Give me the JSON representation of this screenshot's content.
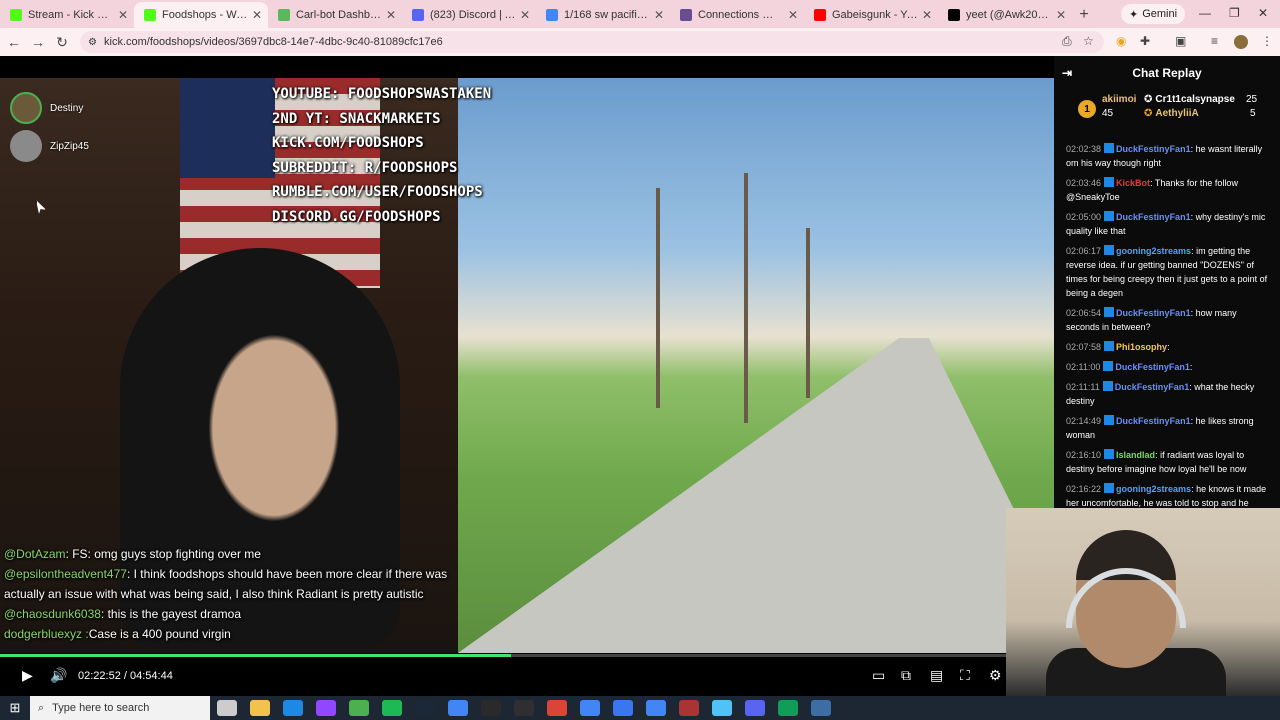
{
  "browser": {
    "tabs": [
      {
        "label": "Stream - Kick Dashboar",
        "favicon": "kick-icon",
        "color": "#53fc18",
        "active": false
      },
      {
        "label": "Foodshops - Watch the",
        "favicon": "kick-icon",
        "color": "#53fc18",
        "active": true
      },
      {
        "label": "Carl-bot Dashboard",
        "favicon": "carl-icon",
        "color": "#5cb85c",
        "active": false
      },
      {
        "label": "(823) Discord | Apps",
        "favicon": "discord-icon",
        "color": "#5865f2",
        "active": false
      },
      {
        "label": "1/168 sw pacific hwy -",
        "favicon": "google-icon",
        "color": "#4285f4",
        "active": false
      },
      {
        "label": "Connections — The Ne",
        "favicon": "nyt-icon",
        "color": "#6a4c93",
        "active": false
      },
      {
        "label": "Gabeisgunk - YouTube",
        "favicon": "youtube-icon",
        "color": "#ff0000",
        "active": false
      },
      {
        "label": "yeet (@Awk20000): \"N",
        "favicon": "x-icon",
        "color": "#000000",
        "active": false
      }
    ],
    "gemini_label": "Gemini",
    "url": "kick.com/foodshops/videos/3697dbc8-14e7-4dbc-9c40-81089cfc17e6",
    "window_controls": {
      "minimize": "—",
      "restore": "❐",
      "close": "✕"
    }
  },
  "video": {
    "stream_links": [
      "YOUTUBE: FOODSHOPSWASTAKEN",
      "2ND YT: SNACKMARKETS",
      "KICK.COM/FOODSHOPS",
      "SUBREDDIT: R/FOODSHOPS",
      "RUMBLE.COM/USER/FOODSHOPS",
      "DISCORD.GG/FOODSHOPS"
    ],
    "voice_users": [
      "Destiny",
      "ZipZip45"
    ],
    "overlay_chat": [
      {
        "user": "@DotAzam",
        "text": ": FS: omg guys stop fighting over me"
      },
      {
        "user": "@epsilontheadvent477",
        "text": ": I think foodshops should have been more clear if there was actually an issue with what was being said, I also think Radiant is pretty autistic"
      },
      {
        "user": "@chaosdunk6038",
        "text": ": this is the gayest dramoa"
      },
      {
        "user": "dodgerbluexyz :",
        "text": "Case is a 400 pound virgin"
      }
    ],
    "progress": 0.485,
    "current_time": "02:22:52",
    "separator": "/",
    "duration": "04:54:44"
  },
  "chat": {
    "title": "Chat Replay",
    "leaderboard": [
      {
        "rank": "1",
        "name": "akiimoi",
        "count": "45",
        "color": "#e9c46a"
      },
      {
        "name": "Cr1t1calsynapse",
        "count": "25",
        "color": "#ffffff"
      },
      {
        "name": "AethyliiA",
        "count": "5",
        "color": "#e9c46a"
      }
    ],
    "messages": [
      {
        "time": "02:02:38",
        "user": "DuckFestinyFan1",
        "color": "#6b8cff",
        "text": ": he wasnt literally om his way though right"
      },
      {
        "time": "02:03:46",
        "user": "KickBot",
        "color": "#e33b3b",
        "text": ": Thanks for the follow @SneakyToe"
      },
      {
        "time": "02:05:00",
        "user": "DuckFestinyFan1",
        "color": "#6b8cff",
        "text": ": why destiny's mic quality like that"
      },
      {
        "time": "02:06:17",
        "user": "gooning2streams",
        "color": "#4ea3ff",
        "text": ": im getting the reverse idea. if ur getting banned \"DOZENS\" of times for being creepy then it just gets to a point of being a degen"
      },
      {
        "time": "02:06:54",
        "user": "DuckFestinyFan1",
        "color": "#6b8cff",
        "text": ": how many seconds in between?"
      },
      {
        "time": "02:07:58",
        "user": "Phi1osophy",
        "color": "#f2c94c",
        "text": ":"
      },
      {
        "time": "02:11:00",
        "user": "DuckFestinyFan1",
        "color": "#6b8cff",
        "text": ":"
      },
      {
        "time": "02:11:11",
        "user": "DuckFestinyFan1",
        "color": "#6b8cff",
        "text": ": what the hecky destiny"
      },
      {
        "time": "02:14:49",
        "user": "DuckFestinyFan1",
        "color": "#6b8cff",
        "text": ": he likes strong woman"
      },
      {
        "time": "02:16:10",
        "user": "Islandlad",
        "color": "#7ed957",
        "text": ": if radiant was loyal to destiny before imagine how loyal he'll be now"
      },
      {
        "time": "02:16:22",
        "user": "gooning2streams",
        "color": "#4ea3ff",
        "text": ": he knows it made her uncomfortable, he was told to stop and he"
      }
    ]
  },
  "taskbar": {
    "search_placeholder": "Type here to search",
    "apps": [
      "task-view-icon",
      "file-explorer-icon",
      "outlook-icon",
      "twitch-icon",
      "chrome-icon",
      "spotify-icon",
      "steam-icon",
      "chrome-icon",
      "epic-icon",
      "obs-icon",
      "chrome-icon",
      "chrome-icon",
      "signal-icon",
      "chrome-icon",
      "app-icon",
      "mic-icon",
      "discord-icon",
      "edge-icon",
      "monitor-icon"
    ]
  }
}
